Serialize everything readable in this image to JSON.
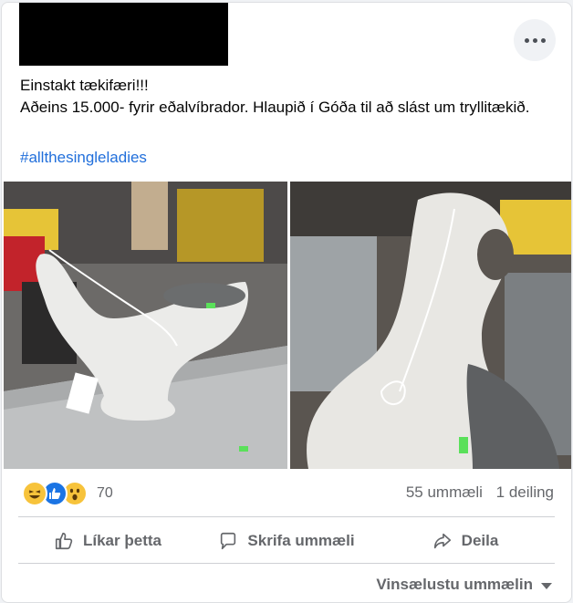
{
  "post": {
    "line1": "Einstakt tækifæri!!!",
    "line2": "Aðeins 15.000- fyrir eðalvíbrador. Hlaupið í Góða til að slást um tryllitækið.",
    "hashtag": "#allthesingleladies"
  },
  "reactions": {
    "icons": [
      "haha-icon",
      "like-icon",
      "wow-icon"
    ],
    "count": "70"
  },
  "stats": {
    "comments": "55 ummæli",
    "shares": "1 deiling"
  },
  "actions": {
    "like": "Líkar þetta",
    "comment": "Skrifa ummæli",
    "share": "Deila"
  },
  "sort": {
    "label": "Vinsælustu ummælin"
  },
  "colors": {
    "link": "#216fdb",
    "secondary_text": "#65676b",
    "like_blue": "#1b74e4",
    "reaction_yellow": "#f7c33b"
  }
}
